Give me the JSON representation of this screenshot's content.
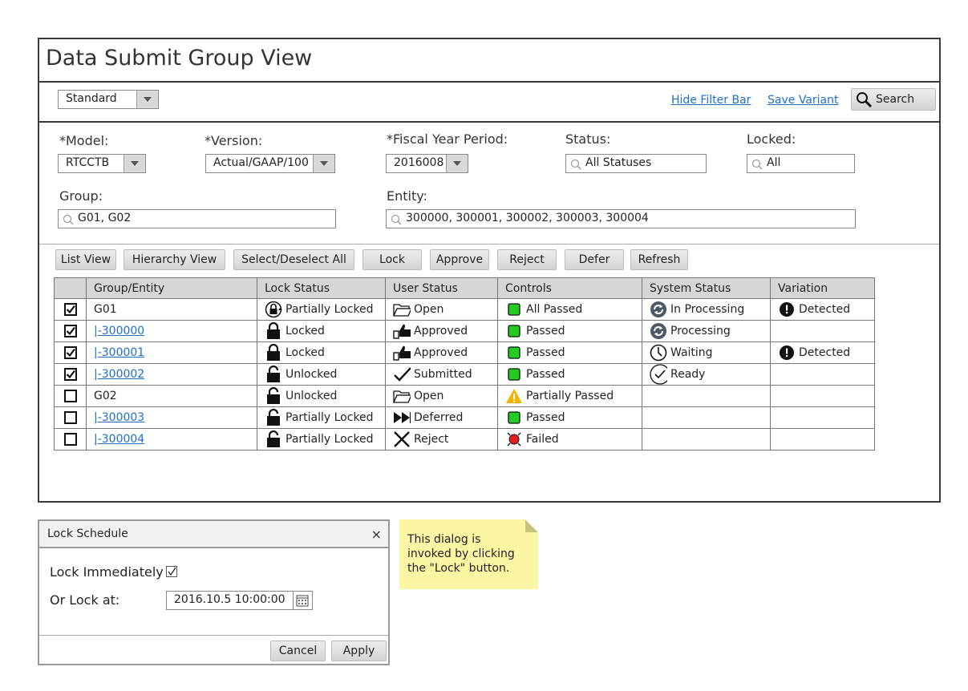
{
  "page": {
    "title": "Data Submit Group View"
  },
  "filter_bar": {
    "variant_value": "Standard",
    "hide_filter_bar": "Hide Filter Bar",
    "save_variant": "Save Variant",
    "search_label": "Search"
  },
  "filters": {
    "model_label": "*Model:",
    "model_value": "RTCCTB",
    "version_label": "*Version:",
    "version_value": "Actual/GAAP/100",
    "fiscal_label": "*Fiscal Year Period:",
    "fiscal_value": "2016008",
    "status_label": "Status:",
    "status_value": "All Statuses",
    "locked_label": "Locked:",
    "locked_value": "All",
    "group_label": "Group:",
    "group_value": "G01, G02",
    "entity_label": "Entity:",
    "entity_value": "300000, 300001, 300002, 300003, 300004"
  },
  "toolbar": {
    "list_view": "List View",
    "hierarchy_view": "Hierarchy View",
    "select_all": "Select/Deselect All",
    "lock": "Lock",
    "approve": "Approve",
    "reject": "Reject",
    "defer": "Defer",
    "refresh": "Refresh"
  },
  "table": {
    "headers": [
      "Group/Entity",
      "Lock Status",
      "User Status",
      "Controls",
      "System Status",
      "Variation"
    ],
    "rows": [
      {
        "checked": true,
        "entity": "G01",
        "is_link": false,
        "lock": "Partially Locked",
        "lock_icon": "partial-lock-icon",
        "user": "Open",
        "user_icon": "folder-open-icon",
        "controls": "All Passed",
        "controls_icon": "green-square-icon",
        "system": "In Processing",
        "system_icon": "processing-icon",
        "variation": "Detected"
      },
      {
        "checked": true,
        "entity": "|-300000",
        "is_link": true,
        "lock": "Locked",
        "lock_icon": "lock-icon",
        "user": "Approved",
        "user_icon": "thumbs-up-icon",
        "controls": "Passed",
        "controls_icon": "green-square-icon",
        "system": "Processing",
        "system_icon": "processing-icon",
        "variation": ""
      },
      {
        "checked": true,
        "entity": "|-300001",
        "is_link": true,
        "lock": "Locked",
        "lock_icon": "lock-icon",
        "user": "Approved",
        "user_icon": "thumbs-up-icon",
        "controls": "Passed",
        "controls_icon": "green-square-icon",
        "system": "Waiting",
        "system_icon": "clock-icon",
        "variation": "Detected"
      },
      {
        "checked": true,
        "entity": "|-300002",
        "is_link": true,
        "lock": "Unlocked",
        "lock_icon": "unlock-icon",
        "user": "Submitted",
        "user_icon": "checkmark-icon",
        "controls": "Passed",
        "controls_icon": "green-square-icon",
        "system": "Ready",
        "system_icon": "check-circle-icon",
        "variation": ""
      },
      {
        "checked": false,
        "entity": "G02",
        "is_link": false,
        "lock": "Unlocked",
        "lock_icon": "unlock-icon",
        "user": "Open",
        "user_icon": "folder-open-icon",
        "controls": "Partially Passed",
        "controls_icon": "warning-icon",
        "system": "",
        "system_icon": "",
        "variation": ""
      },
      {
        "checked": false,
        "entity": "|-300003",
        "is_link": true,
        "lock": "Partially Locked",
        "lock_icon": "unlock-icon",
        "user": "Deferred",
        "user_icon": "fast-forward-icon",
        "controls": "Passed",
        "controls_icon": "green-square-icon",
        "system": "",
        "system_icon": "",
        "variation": ""
      },
      {
        "checked": false,
        "entity": "|-300004",
        "is_link": true,
        "lock": "Partially Locked",
        "lock_icon": "unlock-icon",
        "user": "Reject",
        "user_icon": "x-icon",
        "controls": "Failed",
        "controls_icon": "red-alarm-icon",
        "system": "",
        "system_icon": "",
        "variation": ""
      }
    ]
  },
  "dialog": {
    "title": "Lock Schedule",
    "close": "×",
    "lock_immediately": "Lock Immediately",
    "or_lock_at": "Or Lock at:",
    "datetime_value": "2016.10.5 10:00:00",
    "cancel": "Cancel",
    "apply": "Apply"
  },
  "note": {
    "text": "This dialog is invoked by clicking the \"Lock\" button."
  },
  "colors": {
    "link": "#1f6fc5",
    "note_bg": "#fbf6a3",
    "pass_green": "#22cc22",
    "warning": "#f2b200",
    "fail_red": "#e02020"
  }
}
